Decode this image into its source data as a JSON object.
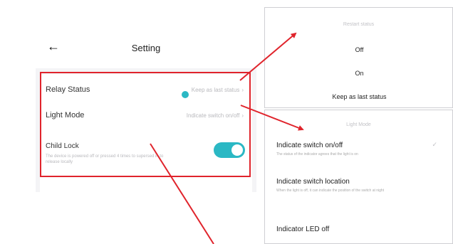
{
  "setting_screen": {
    "title": "Setting",
    "back_icon": "back-arrow-icon",
    "items": [
      {
        "label": "Relay Status",
        "value": "Keep as last status"
      },
      {
        "label": "Light Mode",
        "value": "Indicate switch on/off"
      }
    ],
    "child_lock": {
      "label": "Child Lock",
      "description": "The device is powered off or pressed 4 times to supersed in to release locally",
      "enabled": true
    }
  },
  "restart_popup": {
    "header": "Restart status",
    "options": [
      "Off",
      "On",
      "Keep as last status"
    ],
    "selected_index": 2
  },
  "light_mode_popup": {
    "header": "Light Mode",
    "options": [
      {
        "title": "Indicate switch on/off",
        "description": "The status of the indicator agrees that the light is on"
      },
      {
        "title": "Indicate switch location",
        "description": "When the light is off, it can indicate the position of the switch at night"
      },
      {
        "title": "Indicator LED off",
        "description": ""
      }
    ],
    "selected_index": 0
  },
  "colors": {
    "accent": "#2bb8c4",
    "annotation": "#e0242c"
  }
}
